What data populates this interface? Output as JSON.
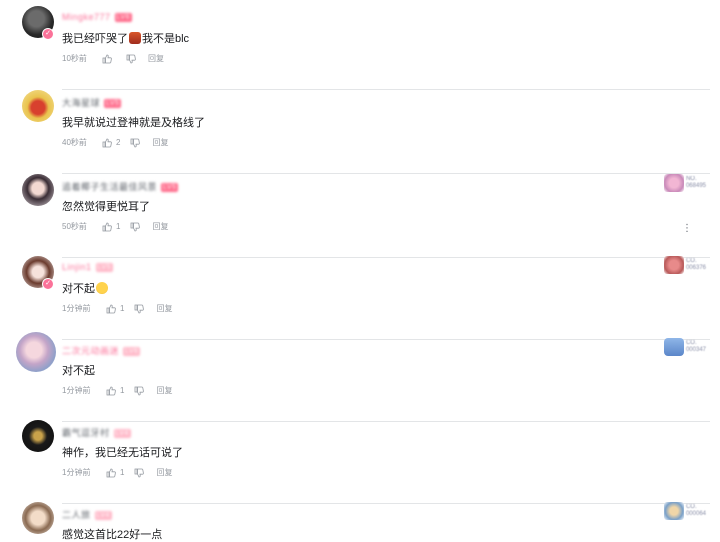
{
  "comments": [
    {
      "username": "Mingke777",
      "username_color": "#fb7299",
      "text_before": "我已经吓哭了",
      "text_after": "我不是blc",
      "has_emoji": true,
      "time": "10秒前",
      "likes": "",
      "reply_label": "回复",
      "vip": true
    },
    {
      "username": "大海星球",
      "username_color": "#61666d",
      "text_before": "我早就说过登神就是及格线了",
      "text_after": "",
      "time": "40秒前",
      "likes": "2",
      "reply_label": "回复",
      "vip": false
    },
    {
      "username": "追着椰子生活最佳风景",
      "username_color": "#61666d",
      "text_before": "忽然觉得更悦耳了",
      "text_after": "",
      "time": "50秒前",
      "likes": "1",
      "reply_label": "回复",
      "vip": false,
      "badge_label": "NO.",
      "badge_number": "068495"
    },
    {
      "username": "Linjin1",
      "username_color": "#fb7299",
      "text_before": "对不起",
      "text_after": "",
      "has_emoji": true,
      "time": "1分钟前",
      "likes": "1",
      "reply_label": "回复",
      "vip": true,
      "badge_label": "CO.",
      "badge_number": "006376"
    },
    {
      "username": "二次元动画迷",
      "username_color": "#fb7299",
      "text_before": "对不起",
      "text_after": "",
      "time": "1分钟前",
      "likes": "1",
      "reply_label": "回复",
      "vip": false,
      "badge_label": "CO.",
      "badge_number": "000347"
    },
    {
      "username": "霸气逗牙村",
      "username_color": "#61666d",
      "text_before": "神作，我已经无话可说了",
      "text_after": "",
      "time": "1分钟前",
      "likes": "1",
      "reply_label": "回复",
      "vip": false
    },
    {
      "username": "二人旅",
      "username_color": "#61666d",
      "text_before": "感觉这首比22好一点",
      "text_after": "",
      "time": "",
      "likes": "",
      "reply_label": "",
      "vip": false,
      "badge_label": "CO.",
      "badge_number": "000064"
    }
  ],
  "colors": {
    "accent_pink": "#fb7299",
    "meta_gray": "#9499a0",
    "divider": "#e3e5e7"
  },
  "icons": {
    "like": "thumb-up-icon",
    "dislike": "thumb-down-icon",
    "more": "more-vertical-icon"
  }
}
